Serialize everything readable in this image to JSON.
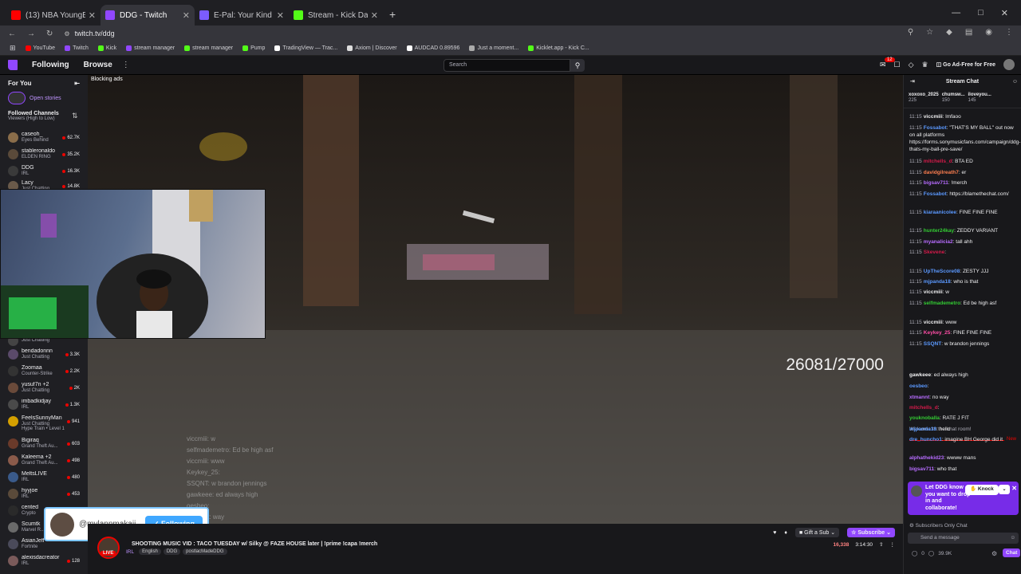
{
  "browser": {
    "tabs": [
      {
        "label": "(13) NBA YoungBoy - Unrel",
        "color": "#ff0000",
        "active": false
      },
      {
        "label": "DDG - Twitch",
        "color": "#9147ff",
        "active": true
      },
      {
        "label": "E-Pal: Your Kind Teammates",
        "color": "#7b5cff",
        "active": false
      },
      {
        "label": "Stream - Kick Dashboard",
        "color": "#53fc18",
        "active": false
      }
    ],
    "url": "twitch.tv/ddg",
    "bookmarks": [
      {
        "label": "YouTube",
        "color": "#ff0000"
      },
      {
        "label": "Twitch",
        "color": "#9147ff"
      },
      {
        "label": "Kick",
        "color": "#53fc18"
      },
      {
        "label": "stream manager",
        "color": "#9147ff"
      },
      {
        "label": "stream manager",
        "color": "#53fc18"
      },
      {
        "label": "Pump",
        "color": "#53fc18"
      },
      {
        "label": "TradingView — Trac...",
        "color": "#ffffff"
      },
      {
        "label": "Axiom | Discover",
        "color": "#dddddd"
      },
      {
        "label": "AUDCAD 0.89596",
        "color": "#ffffff"
      },
      {
        "label": "Just a moment...",
        "color": "#aaaaaa"
      },
      {
        "label": "Kicklet.app - Kick C...",
        "color": "#53fc18"
      }
    ]
  },
  "twitch": {
    "nav": {
      "following": "Following",
      "browse": "Browse",
      "search_placeholder": "Search",
      "ad_free": "Go Ad-Free for Free",
      "notif_count": "12"
    },
    "sidebar": {
      "for_you": "For You",
      "open_stories": "Open stories",
      "followed_title": "Followed Channels",
      "followed_sub": "Viewers (High to Low)",
      "channels": [
        {
          "name": "caseoh_",
          "game": "Eyes Behind",
          "viewers": "62.7K",
          "color": "#8a6d4a"
        },
        {
          "name": "stableronaldo",
          "game": "ELDEN RING",
          "viewers": "35.2K",
          "color": "#5a4a3a"
        },
        {
          "name": "DDG",
          "game": "IRL",
          "viewers": "16.3K",
          "color": "#3a3a3a"
        },
        {
          "name": "Lacy",
          "game": "Just Chatting",
          "viewers": "14.8K",
          "color": "#6a5a4a"
        },
        {
          "name": "",
          "game": "Just Chatting",
          "viewers": "",
          "color": "#444444"
        },
        {
          "name": "bendadonnn",
          "game": "Just Chatting",
          "viewers": "3.3K",
          "color": "#5a4a6a"
        },
        {
          "name": "Zoomaa",
          "game": "Counter-Strike",
          "viewers": "2.2K",
          "color": "#333333"
        },
        {
          "name": "yusuf7n +2",
          "game": "Just Chatting",
          "viewers": "2K",
          "color": "#6a4a3a"
        },
        {
          "name": "imbadkidjay",
          "game": "IRL",
          "viewers": "1.3K",
          "color": "#4a4a4a"
        },
        {
          "name": "FeelsSunnyMan",
          "game": "Just Chatting",
          "viewers": "941",
          "color": "#d4a000"
        },
        {
          "name": "",
          "game": "Hype Train • Level 1",
          "viewers": "",
          "color": "#1f1f23"
        },
        {
          "name": "Bigiraq",
          "game": "Grand Theft Au...",
          "viewers": "603",
          "color": "#6a3a2a"
        },
        {
          "name": "Kaleema +2",
          "game": "Grand Theft Au...",
          "viewers": "498",
          "color": "#8a5a4a"
        },
        {
          "name": "MeltsLIVE",
          "game": "IRL",
          "viewers": "480",
          "color": "#3a5a8a"
        },
        {
          "name": "hyyjoe",
          "game": "IRL",
          "viewers": "453",
          "color": "#5a4a3a"
        },
        {
          "name": "cented",
          "game": "Crypto",
          "viewers": "306",
          "color": "#2a2a2a"
        },
        {
          "name": "Scumtk",
          "game": "Marvel R...",
          "viewers": "",
          "color": "#6a6a6a"
        },
        {
          "name": "AsianJeff",
          "game": "Fortnite",
          "viewers": "",
          "color": "#4a4a5a"
        },
        {
          "name": "alexisdacreator",
          "game": "IRL",
          "viewers": "128",
          "color": "#7a5a5a"
        }
      ]
    },
    "player": {
      "blocking_ads": "Blocking ads",
      "counter": "26081/27000",
      "overlay_chat": [
        "viccmiii: w",
        "selfmademetro: Ed be high asf",
        "viccmiii: www",
        "Keykey_25: ",
        "SSQNT: w brandon jennings",
        "gawkeee: ed always high",
        "oesbeo: ",
        "xtmannt: way",
        ": ",
        "youknoballa: RATE J FIT",
        "mjpanda18: hello",
        "dre_huncho: imagine BH"
      ]
    },
    "follow_card": {
      "handle": "@mylannmakaii",
      "button": "Following"
    },
    "info": {
      "title": "SHOOTING MUSIC VID : TACO TUESDAY w/ Silky @ FAZE HOUSE later | !prime !capa !merch",
      "category": "IRL",
      "tags": [
        "English",
        "DDG",
        "postlacMadeDDG"
      ],
      "live": "LIVE",
      "viewers": "16,338",
      "uptime": "3:14:30",
      "gift_sub": "Gift a Sub",
      "subscribe": "Subscribe"
    },
    "chat": {
      "title": "Stream Chat",
      "gifters": [
        {
          "name": "xoxoxo_2025",
          "count": "225"
        },
        {
          "name": "chumsw...",
          "count": "150"
        },
        {
          "name": "iloveyou...",
          "count": "145"
        }
      ],
      "messages": [
        {
          "time": "11:15",
          "user": "viccmiii",
          "color": "#efeff1",
          "text": ": lmfaoo"
        },
        {
          "time": "11:15",
          "user": "Fossabot",
          "color": "#5b99ff",
          "text": ": \"THAT'S MY BALL\" out now on all platforms https://forms.sonymusicfans.com/campaign/ddg-thats-my-ball-pre-save/"
        },
        {
          "time": "11:15",
          "user": "mitchells_d",
          "color": "#d61a4a",
          "text": ": BTA ED"
        },
        {
          "time": "11:15",
          "user": "davidgilreath7",
          "color": "#ff7f50",
          "text": ": er"
        },
        {
          "time": "11:15",
          "user": "bigsav711",
          "color": "#b76cff",
          "text": ": !merch"
        },
        {
          "time": "11:15",
          "user": "Fossabot",
          "color": "#5b99ff",
          "text": ": https://blamethechat.com/"
        },
        {
          "time": "11:15",
          "user": "kiaraanicolee",
          "color": "#5b99ff",
          "text": ": FINE FINE FINE"
        },
        {
          "time": "11:15",
          "user": "hunter24kay",
          "color": "#33cc33",
          "text": ": ZEDDY VARIANT"
        },
        {
          "time": "11:15",
          "user": "myanalicia2",
          "color": "#b76cff",
          "text": ": tall ahh"
        },
        {
          "time": "11:15",
          "user": "Skevene",
          "color": "#d61a4a",
          "text": ": "
        },
        {
          "time": "11:15",
          "user": "UpTheScore08",
          "color": "#5b99ff",
          "text": ": ZESTY JJJ"
        },
        {
          "time": "11:15",
          "user": "mjpanda18",
          "color": "#5b99ff",
          "text": ": who is that"
        },
        {
          "time": "11:15",
          "user": "viccmiii",
          "color": "#efeff1",
          "text": ": w"
        },
        {
          "time": "11:15",
          "user": "selfmademetro",
          "color": "#33cc33",
          "text": ": Ed be high asf"
        },
        {
          "time": "11:15",
          "user": "viccmiii",
          "color": "#efeff1",
          "text": ": www"
        },
        {
          "time": "11:15",
          "user": "Keykey_25",
          "color": "#ff4da6",
          "text": ": FINE FINE FINE"
        },
        {
          "time": "11:15",
          "user": "SSQNT",
          "color": "#5b99ff",
          "text": ": w brandon jennings"
        }
      ],
      "welcome": "Welcome to the chat room!",
      "new_label": "New",
      "messages2": [
        {
          "user": "gawkeee",
          "color": "#efeff1",
          "text": ": ed always high"
        },
        {
          "user": "oesbeo",
          "color": "#5b99ff",
          "text": ": "
        },
        {
          "user": "xtmannt",
          "color": "#b76cff",
          "text": ": no way"
        },
        {
          "user": "mitchells_d",
          "color": "#d61a4a",
          "text": ": "
        },
        {
          "user": "youknoballa",
          "color": "#33cc33",
          "text": ": RATE J FIT"
        },
        {
          "user": "mjpanda18",
          "color": "#5b99ff",
          "text": ": hello"
        },
        {
          "user": "dre_huncho1",
          "color": "#5b99ff",
          "text": ": imagine BH George did it"
        },
        {
          "user": "alphathekid23",
          "color": "#b76cff",
          "text": ": wwww mans"
        },
        {
          "user": "bigsav711",
          "color": "#b76cff",
          "text": ": who that"
        }
      ],
      "promo": {
        "text": "Let DDG know you want to drop in and collaborate!",
        "knock": "Knock"
      },
      "subs_only": "Subscribers Only Chat",
      "send_placeholder": "Send a message",
      "points": "0",
      "points2": "39.9K",
      "chat_btn": "Chat"
    }
  }
}
